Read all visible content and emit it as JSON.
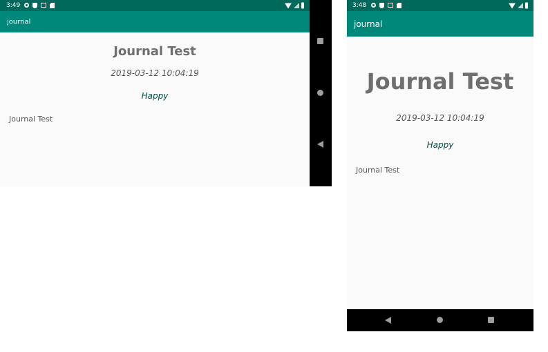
{
  "landscape": {
    "status": {
      "time": "3:49"
    },
    "appbar": {
      "title": "journal"
    },
    "entry": {
      "title": "Journal Test",
      "date": "2019-03-12 10:04:19",
      "mood": "Happy",
      "body": "Journal Test"
    },
    "nav": {
      "icons": [
        "recents-icon",
        "home-icon",
        "back-icon"
      ]
    }
  },
  "portrait": {
    "status": {
      "time": "3:48"
    },
    "appbar": {
      "title": "journal"
    },
    "entry": {
      "title": "Journal Test",
      "date": "2019-03-12 10:04:19",
      "mood": "Happy",
      "body": "Journal Test"
    },
    "nav": {
      "icons": [
        "back-icon",
        "home-icon",
        "recents-icon"
      ]
    }
  },
  "colors": {
    "status_bar": "#00695c",
    "app_bar": "#00897b",
    "background": "#fafafa",
    "mood_text": "#004d40",
    "nav_bar": "#000000"
  }
}
